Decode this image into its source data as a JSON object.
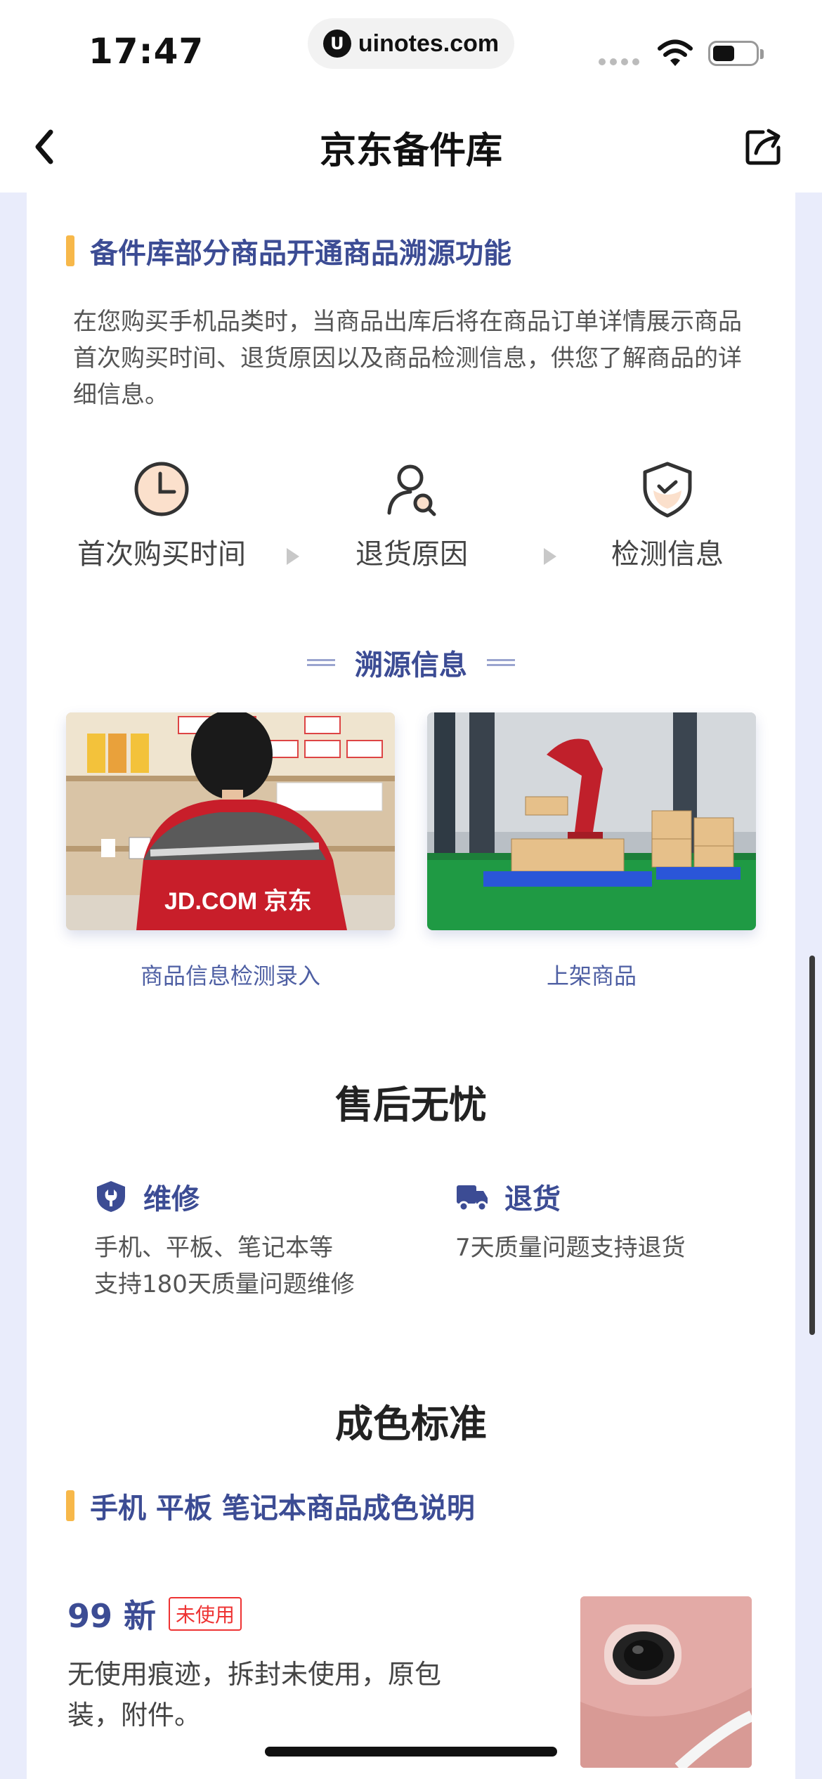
{
  "status": {
    "time": "17:47",
    "url": "uinotes.com",
    "url_logo": "U"
  },
  "nav": {
    "title": "京东备件库"
  },
  "trace_section": {
    "title": "备件库部分商品开通商品溯源功能",
    "intro": "在您购买手机品类时，当商品出库后将在商品订单详情展示商品首次购买时间、退货原因以及商品检测信息，供您了解商品的详细信息。",
    "steps": [
      {
        "label": "首次购买时间",
        "icon": "clock-icon"
      },
      {
        "label": "退货原因",
        "icon": "user-search-icon"
      },
      {
        "label": "检测信息",
        "icon": "shield-check-icon"
      }
    ],
    "subtitle": "溯源信息",
    "photos": [
      {
        "caption": "商品信息检测录入",
        "jacket_text": "JD.COM 京东"
      },
      {
        "caption": "上架商品"
      }
    ]
  },
  "after_sales": {
    "title": "售后无忧",
    "items": [
      {
        "title": "维修",
        "desc_lines": [
          "手机、平板、笔记本等",
          "支持180天质量问题维修"
        ],
        "icon": "shield-wrench-icon"
      },
      {
        "title": "退货",
        "desc_lines": [
          "7天质量问题支持退货"
        ],
        "icon": "truck-icon"
      }
    ]
  },
  "grade": {
    "title": "成色标准",
    "section_title": "手机 平板 笔记本商品成色说明",
    "items": [
      {
        "num": "99 新",
        "badge": "未使用",
        "desc": "无使用痕迹，拆封未使用，原包装，附件。"
      }
    ]
  },
  "colors": {
    "accent": "#3c4c94",
    "bar": "#f7b84a",
    "badge": "#e33333",
    "jd_red": "#c81e2a"
  }
}
